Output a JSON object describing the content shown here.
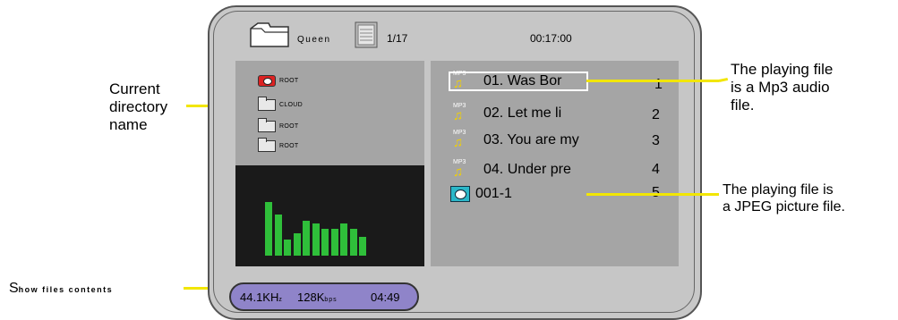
{
  "header": {
    "folder_name": "Queen",
    "file_index": "1/17",
    "elapsed_time": "00:17:00"
  },
  "directories": [
    {
      "label": "ROOT",
      "type": "root-disc"
    },
    {
      "label": "CLOUD",
      "type": "folder"
    },
    {
      "label": "ROOT",
      "type": "folder"
    },
    {
      "label": "ROOT",
      "type": "folder"
    }
  ],
  "tracks": [
    {
      "icon_label": "MP3",
      "title": "01. Was Bor",
      "number": "1"
    },
    {
      "icon_label": "MP3",
      "title": "02. Let me li",
      "number": "2"
    },
    {
      "icon_label": "MP3",
      "title": "03. You are my",
      "number": "3"
    },
    {
      "icon_label": "MP3",
      "title": "04. Under pre",
      "number": "4"
    },
    {
      "icon_label": "",
      "title": "001-1",
      "number": "5"
    }
  ],
  "status": {
    "sample_rate": "44.1KH",
    "sample_rate_unit": "z",
    "bitrate": "128K",
    "bitrate_unit": "bps",
    "duration": "04:49"
  },
  "annotations": {
    "current_directory": [
      "Current",
      "directory",
      "name"
    ],
    "mp3_file": [
      "The playing file",
      "is a Mp3 audio",
      "file."
    ],
    "jpeg_file": [
      "The playing file is",
      "a JPEG picture file."
    ],
    "show_files_initial": "S",
    "show_files_rest": "how files contents"
  },
  "spectrum_levels": [
    0.6,
    0.46,
    0.18,
    0.25,
    0.39,
    0.36,
    0.3,
    0.3,
    0.36,
    0.3,
    0.21
  ],
  "colors": {
    "callout_line": "#f2e600",
    "spectrum_bar": "#2fbf3a",
    "status_pill": "#8f84c9",
    "jpeg_icon": "#2bb7c8"
  }
}
